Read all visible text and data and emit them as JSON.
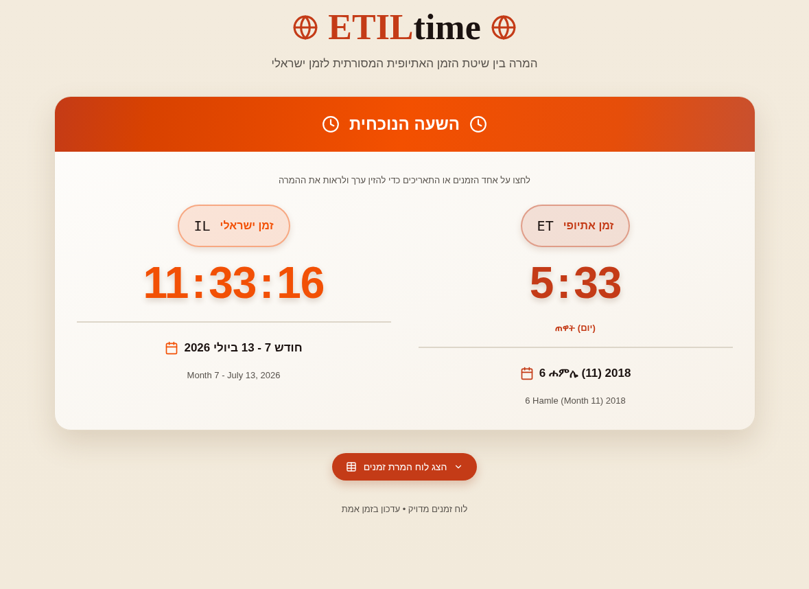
{
  "header": {
    "title_accent": "ETIL",
    "title_rest": "time",
    "subtitle": "המרה בין שיטת הזמן האתיופית המסורתית לזמן ישראלי"
  },
  "card": {
    "title": "השעה הנוכחית",
    "hint": "לחצו על אחד הזמנים או התאריכים כדי להזין ערך ולראות את ההמרה",
    "clocks": [
      {
        "label": "זמן אתיופי",
        "code": "ET",
        "time": "5 : 33",
        "color": "#c43b17",
        "period": "ጠዋት (יום)",
        "date": "6 ሐምሌ (11) 2018",
        "date_latin": "6 Hamle (Month 11) 2018"
      },
      {
        "label": "זמן ישראלי",
        "code": "IL",
        "time": "11 : 33 : 16",
        "color": "#f25005",
        "date": "חודש 7 - 13 ביולי 2026",
        "date_latin": "Month 7 - July 13, 2026"
      }
    ]
  },
  "toggle_button": {
    "label": "הצג לוח המרת זמנים",
    "expanded": false
  },
  "footer": "לוח זמנים מדויק • עדכון בזמן אמת"
}
